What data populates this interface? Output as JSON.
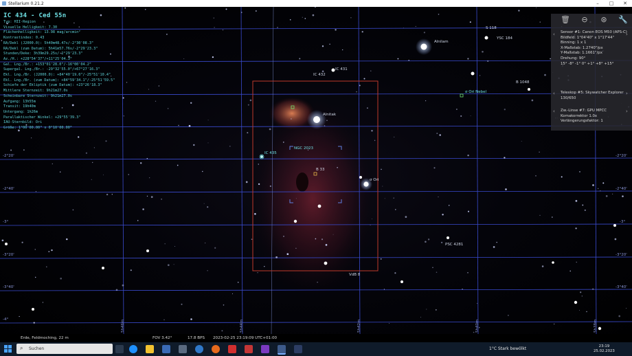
{
  "window": {
    "title": "Stellarium 0.21.2"
  },
  "object": {
    "title": "IC 434 - Ced 55n",
    "lines": [
      "Typ: HII-Region",
      "Visuelle Helligkeit: 7.30",
      "Flächenhelligkeit: 13.98 mag/arcmin²",
      "Kontrastindex: 0.43",
      "RA/Dekl (J2000.0): 5h40m48.47s/-2°30'08.3\"",
      "RA/Dekl (zum Datum): 5h41m57.76s/-2°29'23.3\"",
      "Stunden/Deke: 3h39m29.25s/-2°29'23.3\"",
      "Az./H.: +228°54'37\"/+11°25'04.3\"",
      "Gal. Lng./Br.: +153°01'28.0\"/-16°00'04.2\"",
      "Supergal. Lng./Br.: -29°32'55.0\"/+67°27'16.3\"",
      "Ekl. Lng./Br. (J2000.0): +84°40'19.0\"/-25°51'10.4\"",
      "Ekl. Lng./Br. (zum Datum): +84°59'34.1\"/-25°51'59.5\"",
      "Schiefe der Ekliptik (zum Datum): +23°26'18.3\"",
      "Mittlere Sternzeit: 9h21m27.0s",
      "Scheinbare Sternzeit: 9h21m27.0s",
      "Aufgang: 13h55m",
      "Transit: 19h40m",
      "Untergang: 1h26m",
      "Parallaktischer Winkel: +29°55'39.3\"",
      "IAU-Sternbild: Ori",
      "Größe: 1°00'00.00\" x 0°10'00.00\""
    ]
  },
  "sky_labels": {
    "alnitak": "Alnitak",
    "ic432": "IC 432",
    "ic431": "IC 431",
    "ngc2023": "NGC 2023",
    "ic435": "IC 435",
    "sigma_ori": "σ Ori",
    "vdb8": "VdB 8",
    "alnilam": "Alnilam",
    "ysc184": "YSC 184",
    "b1048": "B 1048",
    "sigma_ori_cluster": "σ Ori Nebel",
    "psc4281": "PSC 4281",
    "s118": "S 118",
    "b33": "B 33"
  },
  "grid_labels": {
    "dec": [
      "-2°20'",
      "-2°40'",
      "-3°",
      "-3°20'",
      "-3°40'",
      "-4°"
    ],
    "ra_bottom": [
      "5h46m",
      "5h44m",
      "5h42m",
      "5h40m",
      "5h38m"
    ]
  },
  "ccd_frame_label": "Sensor #1: Canon EOS M50 (APS-C)",
  "ocular_panel": {
    "sensor": "Sensor #1: Canon EOS M50 (APS-C)",
    "bildfeld": "Bildfeld: 1°04'40\" x 1°17'44\"",
    "binning": "Binning: 1 x 1",
    "x_scale": "X-Maßstab: 1.2740\"/px",
    "y_scale": "Y-Maßstab: 1.1661\"/px",
    "rotation": "Drehung: 90°",
    "misc": "15° -8° -1° 0° +1° +8° +15°",
    "telescope": "Teleskop #5: Skywatcher Explorer 130/650",
    "lens": "Zw.-Linse #7: GPU MPCC Komakorrektor 1.0x",
    "extension": "Verlängerungsfaktor: 1"
  },
  "statusbar": {
    "location": "Erde, Feldmoching, 22 m",
    "fov": "FOV 3.42°",
    "fps": "17.8 BPS",
    "datetime": "2023-02-25 23:19:09 UTC+01:00"
  },
  "taskbar": {
    "search_placeholder": "Suchen",
    "weather": "1°C  Stark bewölkt",
    "time": "23:19",
    "date": "25.02.2023"
  },
  "colors": {
    "grid": "#3a4bd0",
    "ccd": "#c0392b",
    "info_text": "#5fd3d8"
  }
}
